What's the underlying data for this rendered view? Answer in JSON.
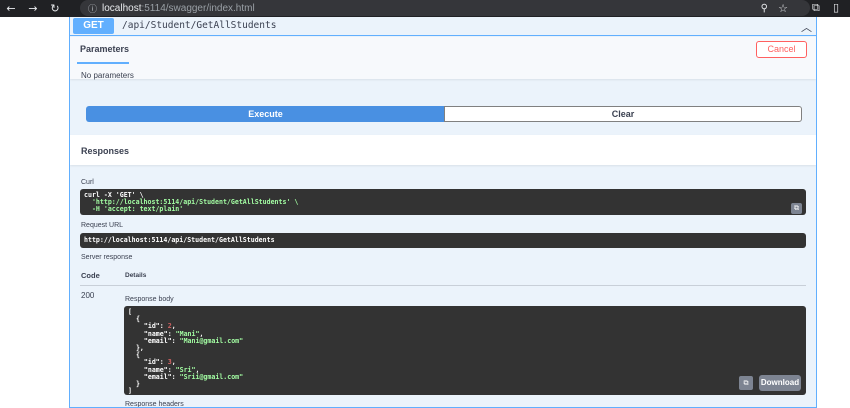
{
  "browser": {
    "url_host": "localhost",
    "url_rest": ":5114/swagger/index.html",
    "back_icon": "arrow-left-icon",
    "forward_icon": "arrow-right-icon",
    "reload_icon": "reload-icon"
  },
  "operation": {
    "method": "GET",
    "path": "/api/Student/GetAllStudents"
  },
  "parameters": {
    "tab_label": "Parameters",
    "cancel_label": "Cancel",
    "empty_text": "No parameters"
  },
  "actions": {
    "execute_label": "Execute",
    "clear_label": "Clear"
  },
  "responses": {
    "title": "Responses",
    "curl_label": "Curl",
    "curl_line1": "curl -X 'GET' \\",
    "curl_line2": "  'http://localhost:5114/api/Student/GetAllStudents' \\",
    "curl_line3": "  -H 'accept: text/plain'",
    "request_url_label": "Request URL",
    "request_url": "http://localhost:5114/api/Student/GetAllStudents",
    "server_response_label": "Server response",
    "code_header": "Code",
    "details_header": "Details",
    "status_code": "200",
    "response_body_label": "Response body",
    "response_body": [
      {
        "id": 2,
        "name": "Mani",
        "email": "Mani@gmail.com"
      },
      {
        "id": 3,
        "name": "Sri",
        "email": "Srii@gmail.com"
      }
    ],
    "download_label": "Download",
    "response_headers_label": "Response headers"
  },
  "colors": {
    "get_accent": "#61affe",
    "execute_blue": "#4990e2",
    "cancel_red": "#ff6060",
    "code_bg": "#333333"
  }
}
